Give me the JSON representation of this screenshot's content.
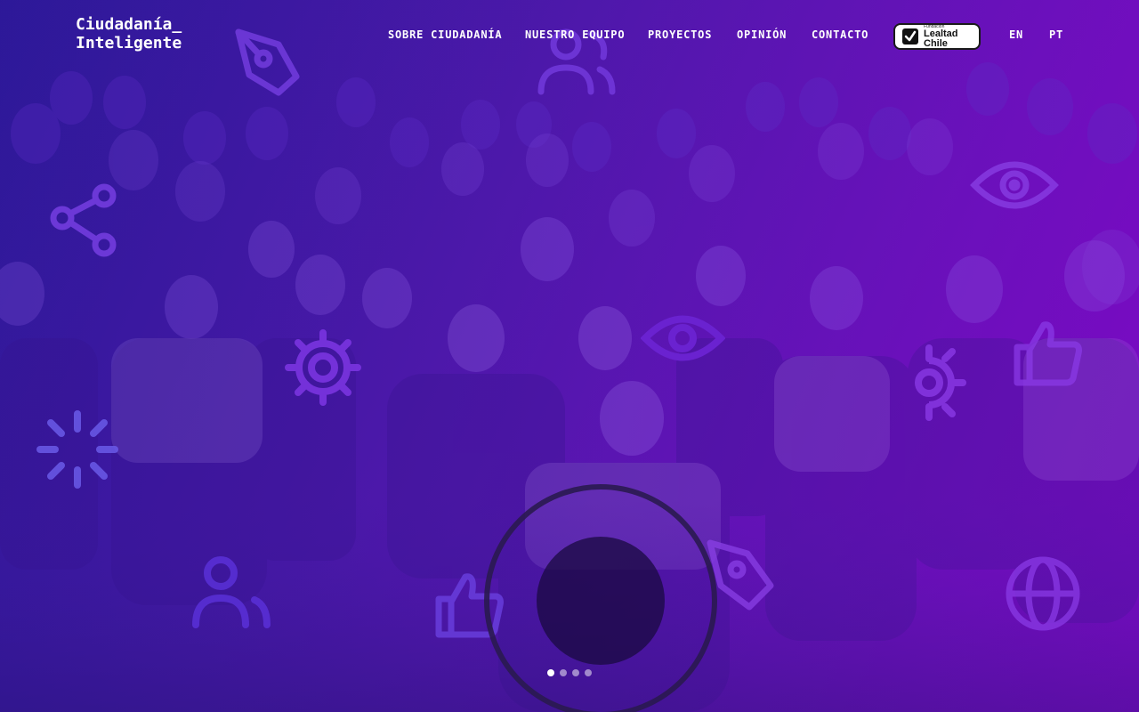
{
  "brand": {
    "line1": "Ciudadanía_",
    "line2": "Inteligente"
  },
  "nav": {
    "items": [
      {
        "label": "SOBRE CIUDADANÍA"
      },
      {
        "label": "NUESTRO EQUIPO"
      },
      {
        "label": "PROYECTOS"
      },
      {
        "label": "OPINIÓN"
      },
      {
        "label": "CONTACTO"
      }
    ],
    "partner_badge": {
      "small": "Fundación",
      "big": "Lealtad Chile"
    },
    "languages": [
      "EN",
      "PT"
    ]
  },
  "slider": {
    "slide_count": 4,
    "active_index": 0
  },
  "colors": {
    "primary": "#4a1aa8",
    "accent": "#7a08c2",
    "icon_stroke": "#6b22d6",
    "text": "#ffffff"
  },
  "decor_icons": [
    "pen-icon",
    "user-icon",
    "share-icon",
    "gear-icon",
    "eye-icon",
    "thumbs-up-icon",
    "globe-icon",
    "spark-icon"
  ]
}
